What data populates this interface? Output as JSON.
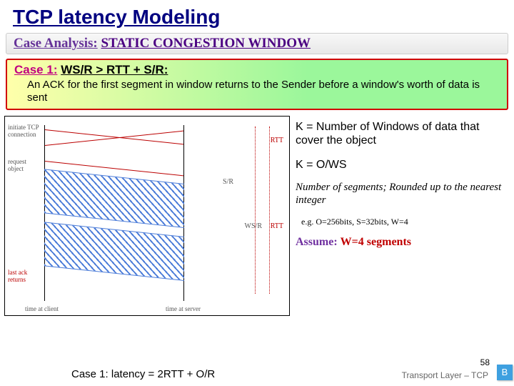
{
  "title": "TCP latency Modeling",
  "subtitle": {
    "label": "Case Analysis:",
    "value": "STATIC CONGESTION WINDOW"
  },
  "case": {
    "label": "Case 1:",
    "condition": "WS/R > RTT + S/R:",
    "description": "An ACK for the first segment in window returns to the Sender before a window's worth of data is sent"
  },
  "diagram": {
    "top_left": "initiate TCP connection",
    "req_obj": "request object",
    "rtt1": "RTT",
    "rtt2": "RTT",
    "sr": "S/R",
    "wsr": "WS/R",
    "last_ack": "last ack returns",
    "time_client": "time at client",
    "time_server": "time at server"
  },
  "side": {
    "k_def": "K = Number of Windows of data that cover the object",
    "k_eq": "K = O/WS",
    "seg_note": "Number of segments; Rounded up to the nearest integer",
    "example": "e.g. O=256bits, S=32bits, W=4",
    "assume_label": "Assume:",
    "assume_val": "W=4 segments"
  },
  "footer": {
    "latency": "Case 1: latency = 2RTT + O/R",
    "layer": "Transport Layer – TCP",
    "page": "58",
    "corner": "B"
  }
}
